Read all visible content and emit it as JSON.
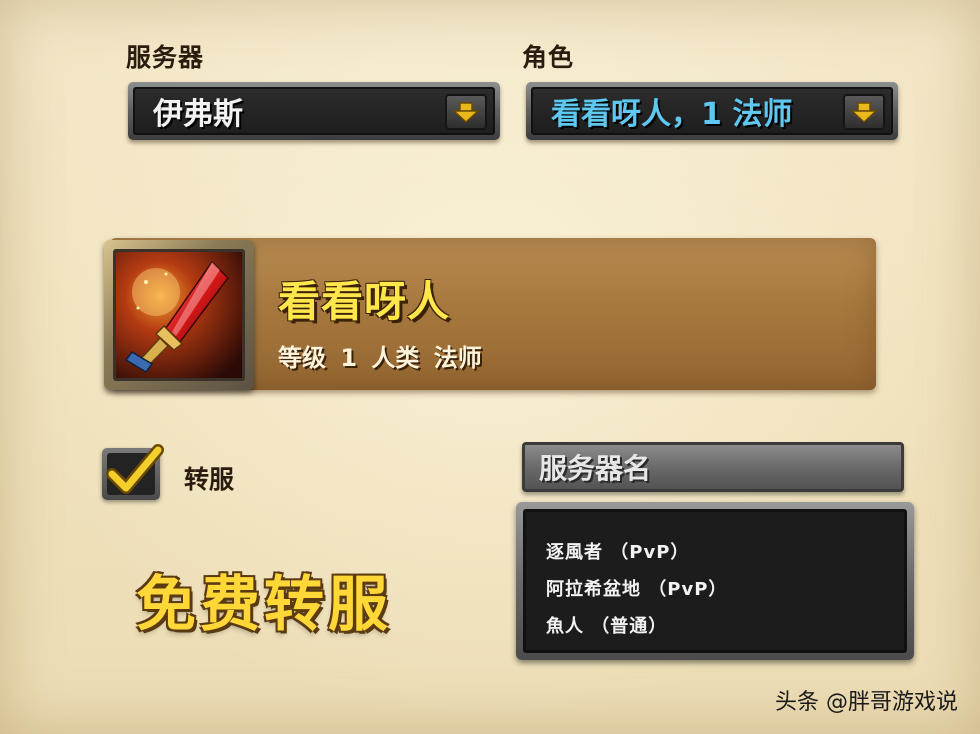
{
  "server_field": {
    "label": "服务器",
    "value": "伊弗斯"
  },
  "character_field": {
    "label": "角色",
    "value": "看看呀人，1 法师"
  },
  "character_card": {
    "name": "看看呀人",
    "info": "等级 1 人类 法师"
  },
  "transfer_checkbox": {
    "label": "转服",
    "checked": true
  },
  "promo_text": "免费转服",
  "server_list": {
    "header": "服务器名",
    "items": [
      "逐風者 （PvP）",
      "阿拉希盆地 （PvP）",
      "魚人 （普通）"
    ]
  },
  "watermark": "头条 @胖哥游戏说",
  "colors": {
    "parchment": "#f1e3bf",
    "character_value": "#5ec8f0",
    "name_gold": "#ffe64a",
    "arrow_gold": "#e8b81c"
  }
}
